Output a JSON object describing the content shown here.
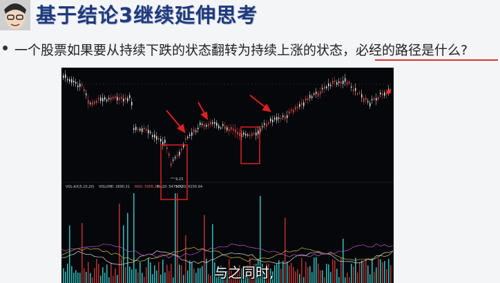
{
  "slide": {
    "title": "基于结论3继续延伸思考",
    "bullet": {
      "text": "一个股票如果要从持续下跌的状态翻转为持续上涨的状态，",
      "highlight": "必经的路径是什么?"
    }
  },
  "chart": {
    "indicator_line": {
      "name": "VOL-AX(5,10,20)",
      "volume": "VOLUME: 2690.31",
      "ma_1": "MA5: 5908.20",
      "ma_2": "MA10: 5475.72",
      "ma_3": "MA20: 6150.94"
    },
    "low_price_label": "9.23"
  },
  "subtitle": "与之同时,",
  "colors": {
    "title": "#1f3a7a",
    "highlight": "#d9302a",
    "chart_background": "#05070a",
    "candle_up": "#e04848",
    "candle_down": "#e8e8e8",
    "annotation": "#e02020"
  }
}
